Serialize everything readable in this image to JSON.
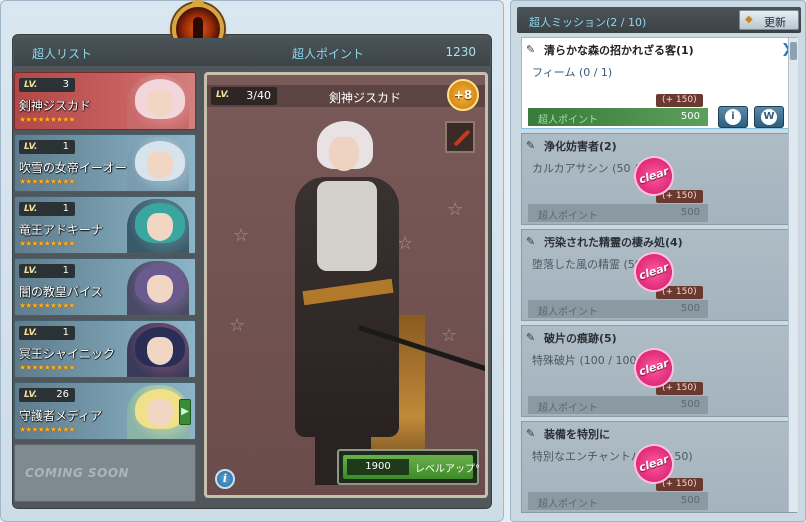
{
  "left": {
    "header_title": "超人リスト",
    "points_label": "超人ポイント",
    "points_value": "1230",
    "coming_soon": "COMING SOON"
  },
  "characters": [
    {
      "lv_tag": "LV.",
      "level": "3",
      "name": "剣神ジスカド",
      "stars": "★★★★★★★★★",
      "hair": "#f2d6dc",
      "bg": "#c86a6a"
    },
    {
      "lv_tag": "LV.",
      "level": "1",
      "name": "吹雪の女帝イーオー",
      "stars": "★★★★★★★★★",
      "hair": "#d8e4ec",
      "bg": "#7a9cb0"
    },
    {
      "lv_tag": "LV.",
      "level": "1",
      "name": "竜王アドキーナ",
      "stars": "★★★★★★★★★",
      "hair": "#3aa6a0",
      "bg": "#5a7c8c"
    },
    {
      "lv_tag": "LV.",
      "level": "1",
      "name": "闇の教皇バイス",
      "stars": "★★★★★★★★★",
      "hair": "#6a5a8e",
      "bg": "#5a6c80"
    },
    {
      "lv_tag": "LV.",
      "level": "1",
      "name": "冥王シャイニック",
      "stars": "★★★★★★★★★",
      "hair": "#2a2e56",
      "bg": "#5a6a80"
    },
    {
      "lv_tag": "LV.",
      "level": "26",
      "name": "守護者メディア",
      "stars": "★★★★★★★★★",
      "hair": "#f0e08a",
      "bg": "#8ab4a8"
    }
  ],
  "detail": {
    "lv_tag": "LV.",
    "level": "3/40",
    "name": "剣神ジスカド",
    "plus": "+8",
    "levelup_cost": "1900",
    "levelup_label": "レベルアップ°",
    "info": "i"
  },
  "missions_panel": {
    "title": "超人ミッション(2 / 10)",
    "refresh_label": "更新"
  },
  "missions": [
    {
      "name": "清らかな森の招かれざる客(1)",
      "progress": "フィーム (0 / 1)",
      "reward_tag": "(+ 150)",
      "pts_label": "超人ポイント",
      "pts_value": "500",
      "status": "active"
    },
    {
      "name": "浄化妨害者(2)",
      "progress": "カルカアサシン (50 / 50)",
      "reward_tag": "(+ 150)",
      "pts_label": "超人ポイント",
      "pts_value": "500",
      "status": "done"
    },
    {
      "name": "汚染された精霊の棲み処(4)",
      "progress": "堕落した風の精霊 (50 / 50)",
      "reward_tag": "(+ 150)",
      "pts_label": "超人ポイント",
      "pts_value": "500",
      "status": "done"
    },
    {
      "name": "破片の痕跡(5)",
      "progress": "特殊破片 (100 / 100)",
      "reward_tag": "(+ 150)",
      "pts_label": "超人ポイント",
      "pts_value": "500",
      "status": "done"
    },
    {
      "name": "装備を特別に",
      "progress": "特別なエンチャントパ (50 / 50)",
      "reward_tag": "(+ 150)",
      "pts_label": "超人ポイント",
      "pts_value": "500",
      "status": "done"
    }
  ],
  "clear_label": "clear",
  "mission_btns": {
    "info": "i",
    "warp": "W"
  }
}
